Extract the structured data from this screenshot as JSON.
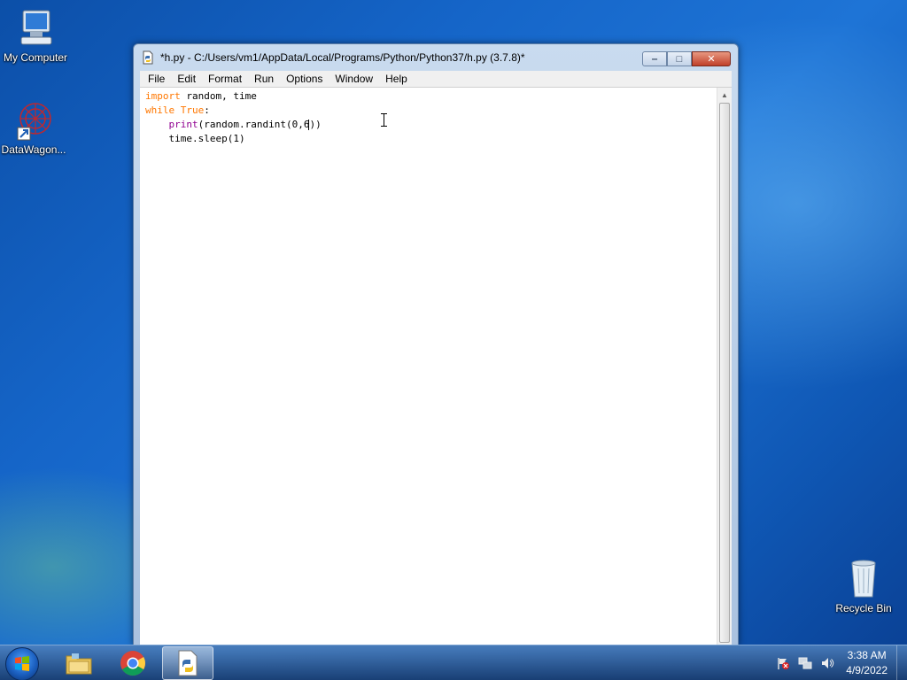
{
  "desktop": {
    "icons": [
      {
        "label": "My Computer"
      },
      {
        "label": "DataWagon..."
      },
      {
        "label": "Recycle Bin"
      }
    ]
  },
  "window": {
    "title": "*h.py - C:/Users/vm1/AppData/Local/Programs/Python/Python37/h.py (3.7.8)*",
    "buttons": {
      "minimize": "‒",
      "maximize": "□",
      "close": "✕"
    },
    "menu": [
      "File",
      "Edit",
      "Format",
      "Run",
      "Options",
      "Window",
      "Help"
    ]
  },
  "editor": {
    "lines": [
      {
        "kw": "import",
        "rest": " random, time"
      },
      {
        "kw": "while",
        "sp": " ",
        "kw2": "True",
        "rest": ":"
      },
      {
        "indent": "    ",
        "bi": "print",
        "rest_before_caret": "(random.randint(0,6",
        "rest_after_caret": "))"
      },
      {
        "indent": "    ",
        "rest": "time.sleep(1)"
      }
    ]
  },
  "taskbar": {
    "clock_time": "3:38 AM",
    "clock_date": "4/9/2022"
  },
  "colors": {
    "keyword": "#ff7700",
    "builtin": "#900090"
  }
}
